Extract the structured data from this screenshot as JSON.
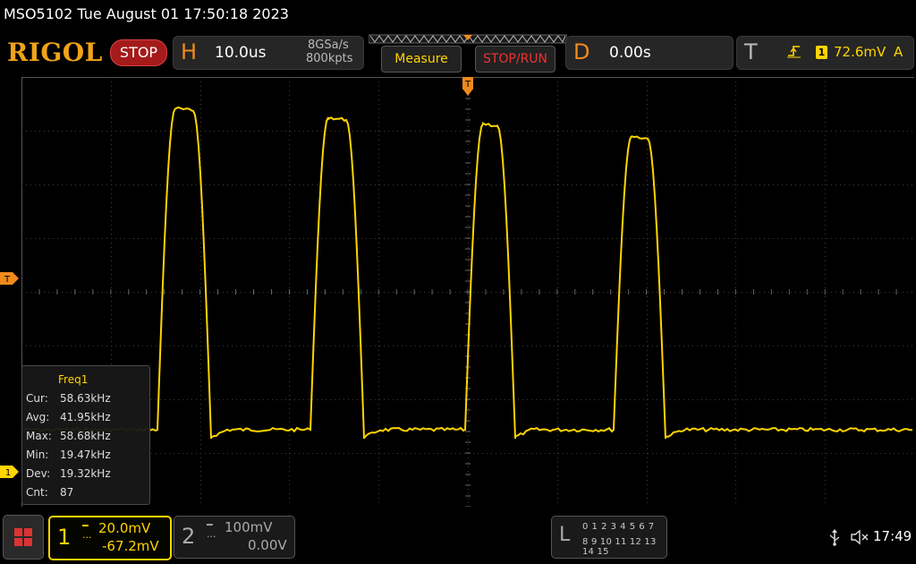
{
  "header": {
    "device_line": "MSO5102  Tue August 01 17:50:18 2023",
    "logo": "RIGOL",
    "run_state": "STOP"
  },
  "horizontal": {
    "letter": "H",
    "timebase": "10.0us",
    "sample_rate": "8GSa/s",
    "memory_depth": "800kpts"
  },
  "buttons": {
    "measure": "Measure",
    "stop_run": "STOP/RUN"
  },
  "delay": {
    "letter": "D",
    "value": "0.00s"
  },
  "trigger": {
    "letter": "T",
    "edge_icon": "rising-edge-icon",
    "source": "1",
    "level": "72.6mV",
    "mode": "A",
    "level_marker": "T",
    "position_marker": "T"
  },
  "measurement": {
    "title": "Freq1",
    "rows": [
      {
        "label": "Cur:",
        "value": "58.63kHz"
      },
      {
        "label": "Avg:",
        "value": "41.95kHz"
      },
      {
        "label": "Max:",
        "value": "58.68kHz"
      },
      {
        "label": "Min:",
        "value": "19.47kHz"
      },
      {
        "label": "Dev:",
        "value": "19.32kHz"
      },
      {
        "label": "Cnt:",
        "value": "87"
      }
    ]
  },
  "channels": [
    {
      "number": "1",
      "scale": "20.0mV",
      "offset": "-67.2mV",
      "active": true,
      "color": "#ffd400"
    },
    {
      "number": "2",
      "scale": "100mV",
      "offset": "0.00V",
      "active": false,
      "color": "#aaaaaa"
    }
  ],
  "channel1_marker": "1",
  "logic": {
    "letter": "L",
    "row1": "0 1 2 3  4 5 6 7",
    "row2": "8 9 10 11 12 13 14 15"
  },
  "status": {
    "clock": "17:49",
    "usb_icon": "usb-icon",
    "speaker_icon": "speaker-muted-icon"
  },
  "colors": {
    "brand": "#f0a418",
    "trace": "#ffd400",
    "stop": "#a51b1b",
    "grid": "#3c3c3c"
  }
}
